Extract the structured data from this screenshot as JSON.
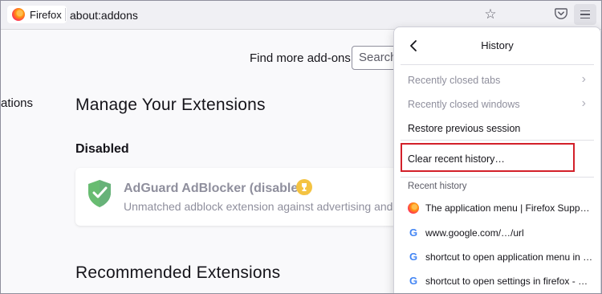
{
  "browser": {
    "name": "Firefox",
    "url": "about:addons"
  },
  "toolbar": {
    "bookmark_icon": "star-icon",
    "pocket_icon": "pocket-icon",
    "menu_icon": "hamburger-menu-icon"
  },
  "page": {
    "sidebar_fragment": "ations",
    "find_more_label": "Find more add-ons",
    "search_placeholder": "Search",
    "manage_title": "Manage Your Extensions",
    "disabled_heading": "Disabled",
    "extension": {
      "name": "AdGuard AdBlocker (disabled)",
      "description": "Unmatched adblock extension against advertising and pop",
      "icon": "shield-check-icon",
      "badge_icon": "trophy-icon"
    },
    "recommended_title": "Recommended Extensions"
  },
  "history_panel": {
    "title": "History",
    "items": [
      {
        "label": "Recently closed tabs",
        "enabled": false
      },
      {
        "label": "Recently closed windows",
        "enabled": false
      },
      {
        "label": "Restore previous session",
        "enabled": true
      }
    ],
    "clear_label": "Clear recent history…",
    "recent_heading": "Recent history",
    "recent": [
      {
        "title": "The application menu | Firefox Suppor…",
        "icon": "firefox-icon"
      },
      {
        "title": "www.google.com/…/url",
        "icon": "google-icon"
      },
      {
        "title": "shortcut to open application menu in f…",
        "icon": "google-icon"
      },
      {
        "title": "shortcut to open settings in firefox - G…",
        "icon": "google-icon"
      }
    ]
  },
  "colors": {
    "highlight_border": "#d3202a",
    "shield_green": "#3ab54a",
    "trophy_gold": "#f4c342"
  }
}
